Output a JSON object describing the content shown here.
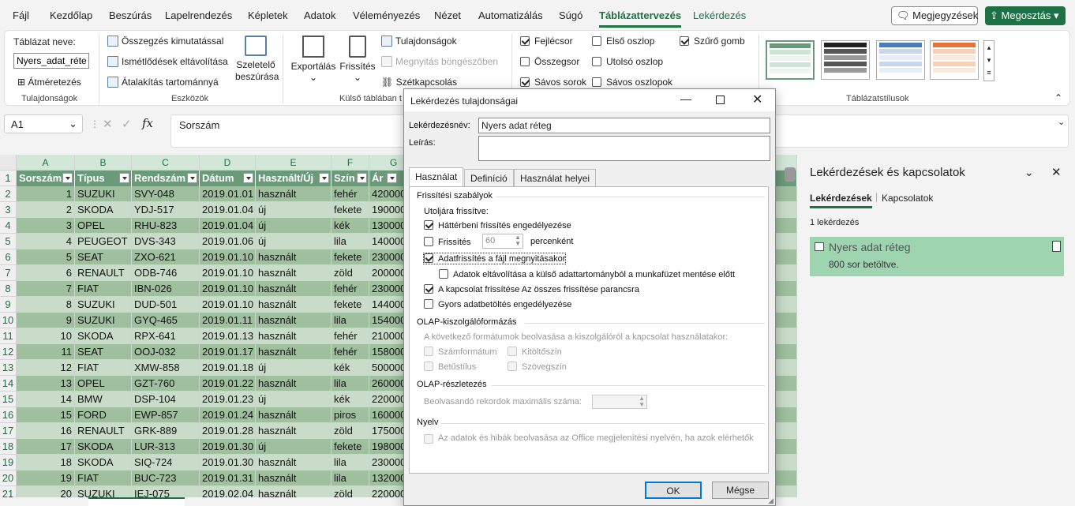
{
  "menu": {
    "items": [
      "Fájl",
      "Kezdőlap",
      "Beszúrás",
      "Lapelrendezés",
      "Képletek",
      "Adatok",
      "Véleményezés",
      "Nézet",
      "Automatizálás",
      "Súgó",
      "Táblázattervezés",
      "Lekérdezés"
    ],
    "comments": "Megjegyzések",
    "share": "Megosztás"
  },
  "ribbon": {
    "props": {
      "table_name_label": "Táblázat neve:",
      "table_name_value": "Nyers_adat_réteg",
      "resize": "Átméretezés",
      "group": "Tulajdonságok"
    },
    "tools": {
      "pivot": "Összegzés kimutatással",
      "dedupe": "Ismétlődések eltávolítása",
      "convert": "Átalakítás tartománnyá",
      "slicer": "Szeletelő beszúrása",
      "group": "Eszközök"
    },
    "external": {
      "export": "Exportálás",
      "refresh": "Frissítés",
      "properties": "Tulajdonságok",
      "browser": "Megnyitás böngészőben",
      "unlink": "Szétkapcsolás",
      "group": "Külső táblában t"
    },
    "options": {
      "header_row": "Fejlécsor",
      "total_row": "Összegsor",
      "banded_rows": "Sávos sorok",
      "first_col": "Első oszlop",
      "last_col": "Utolsó oszlop",
      "banded_cols": "Sávos oszlopok",
      "filter_btn": "Szűrő gomb"
    },
    "styles": {
      "group": "Táblázatstílusok"
    }
  },
  "formula": {
    "namebox": "A1",
    "content": "Sorszám"
  },
  "sheet": {
    "columns": [
      "A",
      "B",
      "C",
      "D",
      "E",
      "F",
      "G"
    ],
    "headers": [
      "Sorszám",
      "Típus",
      "Rendszám",
      "Dátum",
      "Használt/Új",
      "Szín",
      "Ár"
    ],
    "rows": [
      [
        "1",
        "SUZUKI",
        "SVY-048",
        "2019.01.01",
        "használt",
        "fehér",
        "420000"
      ],
      [
        "2",
        "SKODA",
        "YDJ-517",
        "2019.01.04",
        "új",
        "fekete",
        "190000"
      ],
      [
        "3",
        "OPEL",
        "RHU-823",
        "2019.01.04",
        "új",
        "kék",
        "130000"
      ],
      [
        "4",
        "PEUGEOT",
        "DVS-343",
        "2019.01.06",
        "új",
        "lila",
        "140000"
      ],
      [
        "5",
        "SEAT",
        "ZXO-621",
        "2019.01.10",
        "használt",
        "fekete",
        "230000"
      ],
      [
        "6",
        "RENAULT",
        "ODB-746",
        "2019.01.10",
        "használt",
        "zöld",
        "200000"
      ],
      [
        "7",
        "FIAT",
        "IBN-026",
        "2019.01.10",
        "használt",
        "fehér",
        "230000"
      ],
      [
        "8",
        "SUZUKI",
        "DUD-501",
        "2019.01.10",
        "használt",
        "fekete",
        "144000"
      ],
      [
        "9",
        "SUZUKI",
        "GYQ-465",
        "2019.01.11",
        "használt",
        "lila",
        "154000"
      ],
      [
        "10",
        "SKODA",
        "RPX-641",
        "2019.01.13",
        "használt",
        "fehér",
        "210000"
      ],
      [
        "11",
        "SEAT",
        "OOJ-032",
        "2019.01.17",
        "használt",
        "fehér",
        "158000"
      ],
      [
        "12",
        "FIAT",
        "XMW-858",
        "2019.01.18",
        "új",
        "kék",
        "500000"
      ],
      [
        "13",
        "OPEL",
        "GZT-760",
        "2019.01.22",
        "használt",
        "lila",
        "260000"
      ],
      [
        "14",
        "BMW",
        "DSP-104",
        "2019.01.23",
        "új",
        "kék",
        "220000"
      ],
      [
        "15",
        "FORD",
        "EWP-857",
        "2019.01.24",
        "használt",
        "piros",
        "160000"
      ],
      [
        "16",
        "RENAULT",
        "GRK-889",
        "2019.01.28",
        "használt",
        "zöld",
        "175000"
      ],
      [
        "17",
        "SKODA",
        "LUR-313",
        "2019.01.30",
        "új",
        "fekete",
        "198000"
      ],
      [
        "18",
        "SKODA",
        "SIQ-724",
        "2019.01.30",
        "használt",
        "lila",
        "230000"
      ],
      [
        "19",
        "FIAT",
        "BUC-723",
        "2019.01.31",
        "használt",
        "lila",
        "132000"
      ],
      [
        "20",
        "SUZUKI",
        "IEJ-075",
        "2019.02.04",
        "használt",
        "zöld",
        "220000"
      ]
    ],
    "rownums": [
      "1",
      "2",
      "3",
      "4",
      "5",
      "6",
      "7",
      "8",
      "9",
      "10",
      "11",
      "12",
      "13",
      "14",
      "15",
      "16",
      "17",
      "18",
      "19",
      "20",
      "21"
    ]
  },
  "dialog": {
    "title": "Lekérdezés tulajdonságai",
    "name_label": "Lekérdezésnév:",
    "name_value": "Nyers adat réteg",
    "desc_label": "Leírás:",
    "tabs": [
      "Használat",
      "Definíció",
      "Használat helyei"
    ],
    "refresh_section": "Frissítési szabályok",
    "last_refreshed": "Utoljára frissítve:",
    "bg_refresh": "Háttérbeni frissítés engedélyezése",
    "refresh_every": "Frissítés",
    "refresh_minutes": "60",
    "per_minute": "percenként",
    "refresh_on_open": "Adatfrissítés a fájl megnyitásakor",
    "remove_data": "Adatok eltávolítása a külső adattartományból a munkafüzet mentése előtt",
    "refresh_all": "A kapcsolat frissítése Az összes frissítése parancsra",
    "fast_load": "Gyors adatbetöltés engedélyezése",
    "olap_format": "OLAP-kiszolgálóformázás",
    "olap_format_desc": "A következő formátumok beolvasása a kiszolgálóról a kapcsolat használatakor:",
    "num_format": "Számformátum",
    "fill_color": "Kitöltőszín",
    "font_style": "Betűstílus",
    "text_color": "Szövegszín",
    "olap_drill": "OLAP-részletezés",
    "max_records": "Beolvasandó rekordok maximális száma:",
    "language": "Nyelv",
    "lang_desc": "Az adatok és hibák beolvasása az Office megjelenítési nyelvén, ha azok elérhetők",
    "ok": "OK",
    "cancel": "Mégse"
  },
  "panel": {
    "title": "Lekérdezések és kapcsolatok",
    "tab_queries": "Lekérdezések",
    "tab_connections": "Kapcsolatok",
    "count": "1 lekérdezés",
    "query_name": "Nyers adat réteg",
    "query_rows": "800 sor betöltve."
  },
  "colors": {
    "accent": "#1e7145",
    "table_header": "#6a9a7a",
    "table_band": "#9fbf9f"
  }
}
